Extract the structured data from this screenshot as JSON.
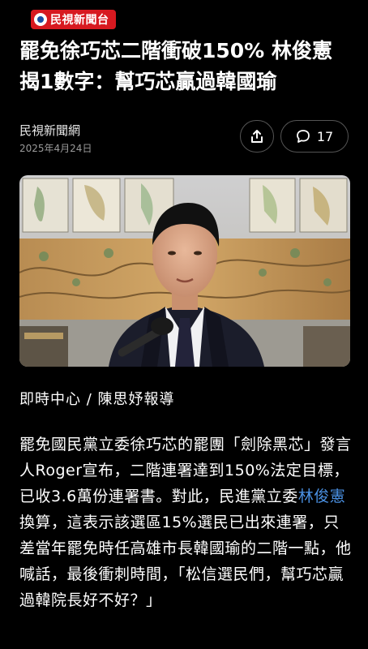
{
  "header": {
    "brand": "民視新聞台"
  },
  "article": {
    "headline": "罷免徐巧芯二階衝破150% 林俊憲揭1數字：幫巧芯贏過韓國瑜",
    "source": "民視新聞網",
    "date": "2025年4月24日",
    "comment_count": "17",
    "byline": "即時中心 / 陳思妤報導",
    "body_part1": "罷免國民黨立委徐巧芯的罷團「劍除黑芯」發言人Roger宣布，二階連署達到150%法定目標，已收3.6萬份連署書。對此，民進黨立委",
    "body_link": "林俊憲",
    "body_part2": "換算，這表示該選區15%選民已出來連署，只差當年罷免時任高雄市長韓國瑜的二階一點，他喊話，最後衝刺時間，「松信選民們，幫巧芯贏過韓院長好不好？」"
  },
  "colors": {
    "background": "#000000",
    "brand_red": "#d71920",
    "link_blue": "#4a90e2"
  },
  "icons": {
    "share": "share-icon",
    "comment": "comment-icon"
  }
}
